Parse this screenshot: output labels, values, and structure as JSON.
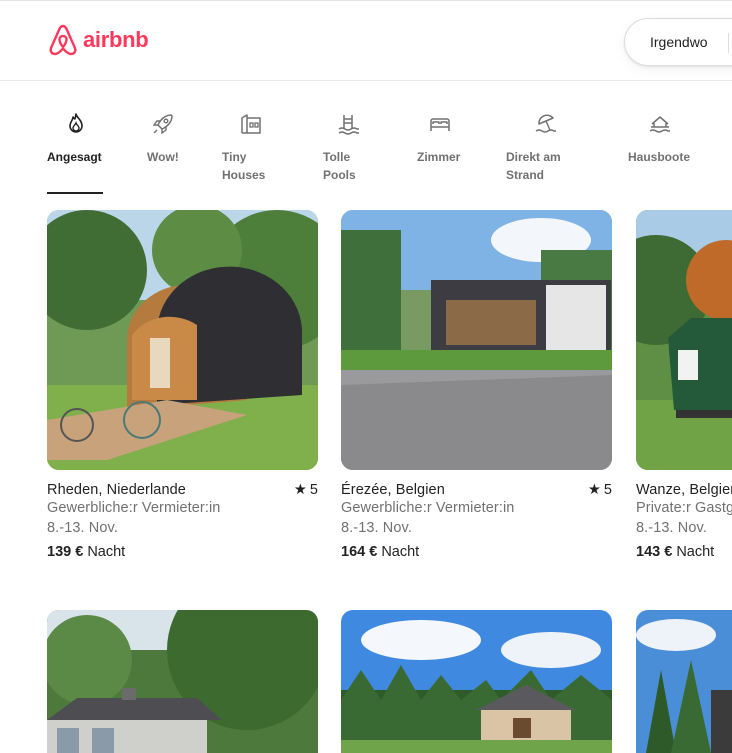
{
  "header": {
    "logo_text": "airbnb",
    "search_location": "Irgendwo"
  },
  "categories": [
    {
      "id": "trending",
      "label_lines": [
        "Angesagt"
      ],
      "active": true,
      "icon": "flame-icon"
    },
    {
      "id": "wow",
      "label_lines": [
        "Wow!"
      ],
      "active": false,
      "icon": "rocket-icon"
    },
    {
      "id": "tiny",
      "label_lines": [
        "Tiny",
        "Houses"
      ],
      "active": false,
      "icon": "tiny-house-icon"
    },
    {
      "id": "pools",
      "label_lines": [
        "Tolle",
        "Pools"
      ],
      "active": false,
      "icon": "pool-icon"
    },
    {
      "id": "rooms",
      "label_lines": [
        "Zimmer"
      ],
      "active": false,
      "icon": "bed-icon"
    },
    {
      "id": "beach",
      "label_lines": [
        "Direkt am",
        "Strand"
      ],
      "active": false,
      "icon": "beach-umbrella-icon"
    },
    {
      "id": "boats",
      "label_lines": [
        "Hausboote"
      ],
      "active": false,
      "icon": "houseboat-icon"
    }
  ],
  "listings": [
    {
      "title": "Rheden, Niederlande",
      "rating": "5",
      "host": "Gewerbliche:r Vermieter:in",
      "dates": "8.-13. Nov.",
      "price": "139 €",
      "per": "Nacht",
      "image": "wooden-pod-cabin"
    },
    {
      "title": "Érezée, Belgien",
      "rating": "5",
      "host": "Gewerbliche:r Vermieter:in",
      "dates": "8.-13. Nov.",
      "price": "164 €",
      "per": "Nacht",
      "image": "modern-cabin-gravel"
    },
    {
      "title": "Wanze, Belgien",
      "rating": "",
      "host": "Private:r Gastgeber:in",
      "dates": "8.-13. Nov.",
      "price": "143 €",
      "per": "Nacht",
      "image": "green-tiny-house"
    },
    {
      "title": "",
      "rating": "",
      "host": "",
      "dates": "",
      "price": "",
      "per": "",
      "image": "house-in-trees"
    },
    {
      "title": "",
      "rating": "",
      "host": "",
      "dates": "",
      "price": "",
      "per": "",
      "image": "small-cabin-forest"
    },
    {
      "title": "",
      "rating": "",
      "host": "",
      "dates": "",
      "price": "",
      "per": "",
      "image": "trees-blue-sky"
    }
  ],
  "colors": {
    "brand": "#ff385c",
    "text": "#222222",
    "muted": "#717171"
  }
}
